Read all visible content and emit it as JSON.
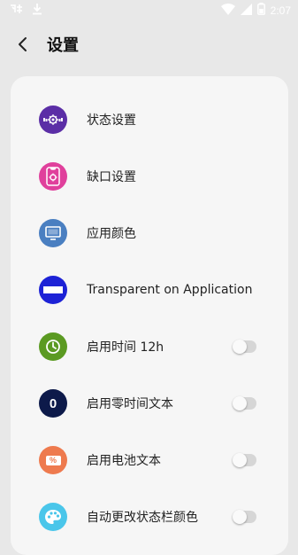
{
  "status_bar": {
    "time": "2:07"
  },
  "header": {
    "title": "设置"
  },
  "settings": [
    {
      "label": "状态设置",
      "icon": "status-settings-icon",
      "color": "#5b2ea6"
    },
    {
      "label": "缺口设置",
      "icon": "notch-settings-icon",
      "color": "#e0409c"
    },
    {
      "label": "应用颜色",
      "icon": "app-color-icon",
      "color": "#4a7fc1"
    },
    {
      "label": "Transparent on Application",
      "icon": "transparent-icon",
      "color": "#1d22d6"
    },
    {
      "label": "启用时间 12h",
      "icon": "clock-icon",
      "color": "#5b9a22",
      "toggle": false
    },
    {
      "label": "启用零时间文本",
      "icon": "zero-icon",
      "color": "#0d1a4a",
      "toggle": false
    },
    {
      "label": "启用电池文本",
      "icon": "battery-percent-icon",
      "color": "#ee7a4e",
      "toggle": false
    },
    {
      "label": "自动更改状态栏颜色",
      "icon": "palette-icon",
      "color": "#4ac6ea",
      "toggle": false
    }
  ],
  "zero_icon_text": "0",
  "percent_icon_text": "%"
}
